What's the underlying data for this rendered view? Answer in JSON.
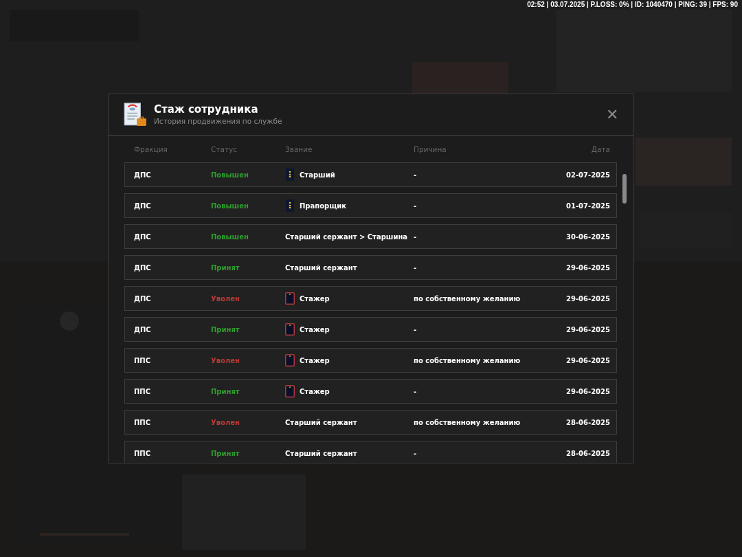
{
  "status_bar": {
    "text": "02:52 | 03.07.2025 | P.LOSS: 0% | ID: 1040470 | PING: 39 | FPS: 90"
  },
  "dialog": {
    "title": "Стаж сотрудника",
    "subtitle": "История продвижения по службе",
    "close": "✕",
    "columns": [
      "Фракция",
      "Статус",
      "Звание",
      "Причина",
      "Дата"
    ],
    "rows": [
      {
        "faction": "ДПС",
        "status": {
          "text": "Повышен",
          "kind": "positive"
        },
        "rank": {
          "text": "Старший",
          "kind": "stars"
        },
        "reason": "-",
        "date": "02-07-2025"
      },
      {
        "faction": "ДПС",
        "status": {
          "text": "Повышен",
          "kind": "positive"
        },
        "rank": {
          "text": "Прапорщик",
          "kind": "stars"
        },
        "reason": "-",
        "date": "01-07-2025"
      },
      {
        "faction": "ДПС",
        "status": {
          "text": "Повышен",
          "kind": "positive"
        },
        "rank": {
          "text": "Старший сержант > Старшина"
        },
        "reason": "-",
        "date": "30-06-2025"
      },
      {
        "faction": "ДПС",
        "status": {
          "text": "Принят",
          "kind": "positive"
        },
        "rank": {
          "text": "Старший сержант"
        },
        "reason": "-",
        "date": "29-06-2025"
      },
      {
        "faction": "ДПС",
        "status": {
          "text": "Уволен",
          "kind": "negative"
        },
        "rank": {
          "text": "Стажер",
          "kind": "trainee"
        },
        "reason": "по собственному желанию",
        "date": "29-06-2025"
      },
      {
        "faction": "ДПС",
        "status": {
          "text": "Принят",
          "kind": "positive"
        },
        "rank": {
          "text": "Стажер",
          "kind": "trainee"
        },
        "reason": "-",
        "date": "29-06-2025"
      },
      {
        "faction": "ППС",
        "status": {
          "text": "Уволен",
          "kind": "negative"
        },
        "rank": {
          "text": "Стажер",
          "kind": "trainee"
        },
        "reason": "по собственному желанию",
        "date": "29-06-2025"
      },
      {
        "faction": "ППС",
        "status": {
          "text": "Принят",
          "kind": "positive"
        },
        "rank": {
          "text": "Стажер",
          "kind": "trainee"
        },
        "reason": "-",
        "date": "29-06-2025"
      },
      {
        "faction": "ППС",
        "status": {
          "text": "Уволен",
          "kind": "negative"
        },
        "rank": {
          "text": "Старший сержант"
        },
        "reason": "по собственному желанию",
        "date": "28-06-2025"
      },
      {
        "faction": "ППС",
        "status": {
          "text": "Принят",
          "kind": "positive"
        },
        "rank": {
          "text": "Старший сержант"
        },
        "reason": "-",
        "date": "28-06-2025"
      }
    ]
  }
}
